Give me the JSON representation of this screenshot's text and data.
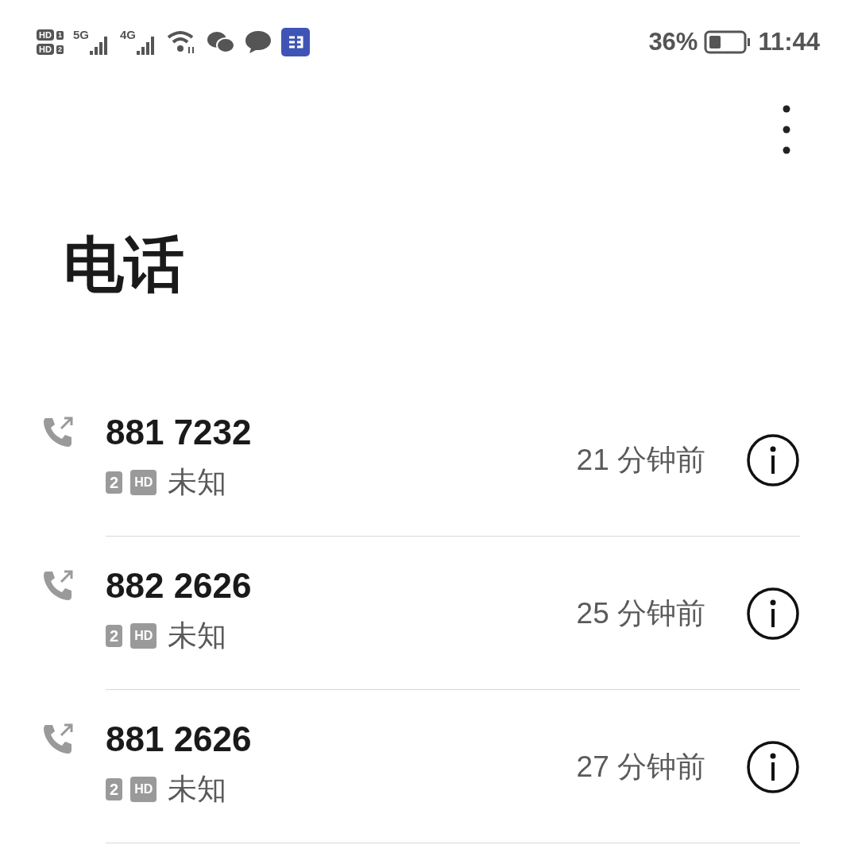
{
  "status_bar": {
    "sims": [
      {
        "label": "HD",
        "slot": "1"
      },
      {
        "label": "HD",
        "slot": "2"
      }
    ],
    "networks": [
      "5G",
      "4G"
    ],
    "battery": "36%",
    "time": "11:44"
  },
  "title": "电话",
  "calls": [
    {
      "kind": "outgoing",
      "number": "881 7232",
      "sim": "2",
      "hd": "HD",
      "location": "未知",
      "time": "21 分钟前"
    },
    {
      "kind": "outgoing",
      "number": "882 2626",
      "sim": "2",
      "hd": "HD",
      "location": "未知",
      "time": "25 分钟前"
    },
    {
      "kind": "outgoing",
      "number": "881 2626",
      "sim": "2",
      "hd": "HD",
      "location": "未知",
      "time": "27 分钟前"
    }
  ]
}
